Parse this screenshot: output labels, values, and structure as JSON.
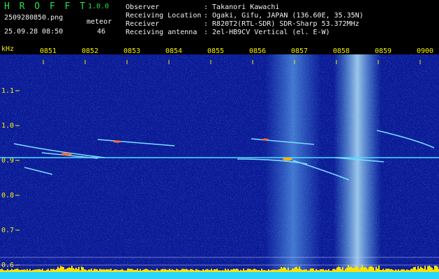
{
  "app": {
    "title": "H R O F F T",
    "version": "1.0.0"
  },
  "file": {
    "name": "2509280850.png",
    "datetime": "25.09.28 08:50"
  },
  "meteor": {
    "label": "meteor",
    "count": "46"
  },
  "info": [
    {
      "label": "Observer",
      "value": ": Takanori Kawachi"
    },
    {
      "label": "Receiving Location",
      "value": ": Ogaki, Gifu, JAPAN (136.60E, 35.35N)"
    },
    {
      "label": "Receiver",
      "value": ": R820T2(RTL-SDR) SDR-Sharp 53.372MHz"
    },
    {
      "label": "Receiving antenna",
      "value": ": 2el-HB9CV Vertical (el. E-W)"
    }
  ],
  "axis": {
    "y_unit": "kHz",
    "y_ticks": [
      "1.1",
      "1.0",
      "0.9",
      "0.8",
      "0.7",
      "0.6"
    ],
    "x_ticks": [
      "0851",
      "0852",
      "0853",
      "0854",
      "0855",
      "0856",
      "0857",
      "0858",
      "0859",
      "0900"
    ]
  },
  "colors": {
    "background": "#0a1890",
    "reference_line": "#4ee0ff",
    "meteor_trail": "#7bdcff",
    "hot": "#ff6a3a",
    "power_bar": "#ffe000",
    "power_base": "#27d7ff"
  }
}
